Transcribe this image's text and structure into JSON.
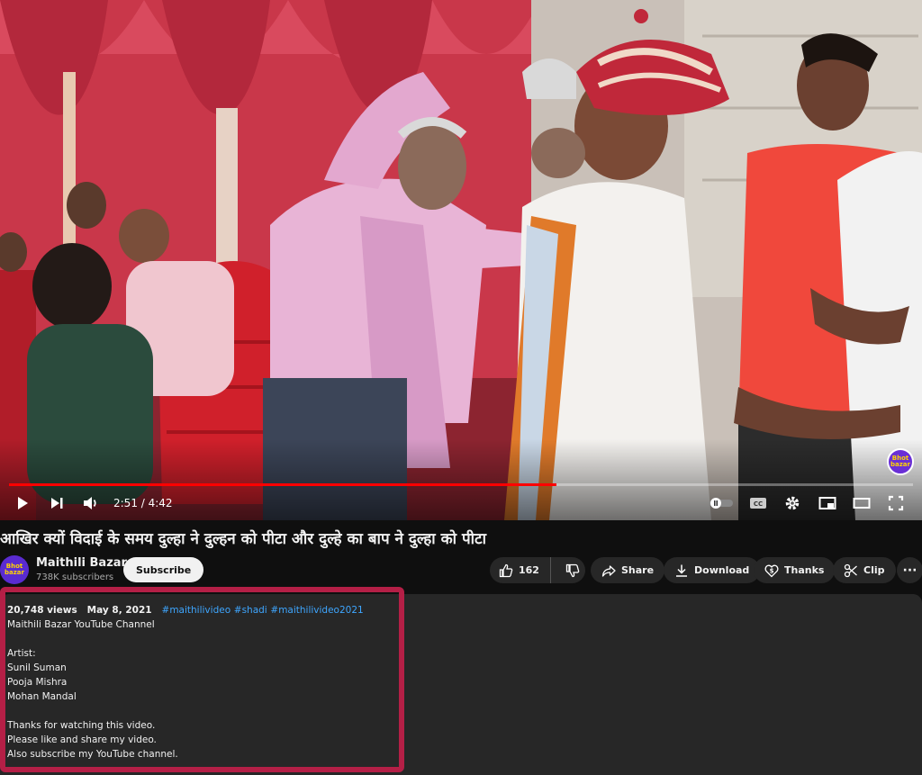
{
  "player": {
    "current_time": "2:51",
    "duration": "4:42",
    "time_display": "2:51 / 4:42",
    "progress": 0.606,
    "watermark": "Bhot bazar",
    "accent_color": "#ff0000"
  },
  "video": {
    "title": "आखिर क्यों विदाई के समय दुल्हा ने दुल्हन को पीटा और दुल्हे का बाप ने दुल्हा को पीटा"
  },
  "channel": {
    "name": "Maithili Bazar",
    "subscribers": "738K subscribers",
    "subscribe_label": "Subscribe",
    "avatar_text": "Bhot bazar"
  },
  "actions": {
    "like_count": "162",
    "share": "Share",
    "download": "Download",
    "thanks": "Thanks",
    "clip": "Clip",
    "more": "···"
  },
  "description": {
    "views": "20,748 views",
    "date": "May 8, 2021",
    "hashtags": [
      "#maithilivideo",
      "#shadi",
      "#maithilivideo2021"
    ],
    "lines": [
      "Maithili Bazar YouTube Channel",
      "",
      "Artist:",
      "Sunil Suman",
      "Pooja Mishra",
      "Mohan Mandal",
      "",
      "Thanks for watching this video.",
      "Please like and share my video.",
      "Also subscribe my YouTube channel."
    ],
    "highlight_color": "#b41f46"
  }
}
